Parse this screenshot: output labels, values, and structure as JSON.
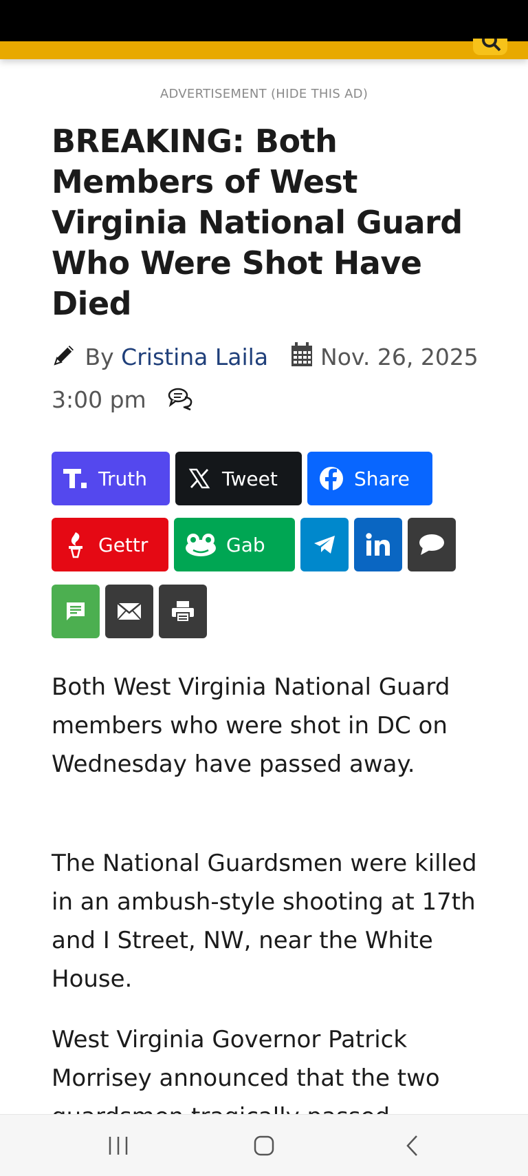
{
  "header": {
    "search_icon": "search-icon"
  },
  "ad": {
    "label": "ADVERTISEMENT (HIDE THIS AD)"
  },
  "article": {
    "title": "BREAKING: Both Members of West Virginia National Guard Who Were Shot Have Died",
    "byline_prefix": "By",
    "author": "Cristina Laila",
    "date": "Nov. 26, 2025 3:00 pm",
    "paragraphs": [
      "Both West Virginia National Guard members who were shot in DC on Wednesday have passed away.",
      "The National Guardsmen were killed in an ambush-style shooting at 17th and I Street, NW, near the White House.",
      "West Virginia Governor Patrick Morrisey announced that the two guardsmen tragically passed"
    ]
  },
  "share": {
    "truth": {
      "label": "Truth",
      "color": "#5448ee"
    },
    "tweet": {
      "label": "Tweet",
      "color": "#14171a"
    },
    "facebook": {
      "label": "Share",
      "color": "#0866ff"
    },
    "gettr": {
      "label": "Gettr",
      "color": "#e50914"
    },
    "gab": {
      "label": "Gab",
      "color": "#00a653"
    },
    "telegram": {
      "color": "#0088cc"
    },
    "linkedin": {
      "color": "#0a66c2"
    },
    "comment": {
      "color": "#3a3a3a"
    },
    "sms": {
      "color": "#4caf50"
    },
    "email": {
      "color": "#3a3a3a"
    },
    "print": {
      "color": "#3a3a3a"
    }
  }
}
